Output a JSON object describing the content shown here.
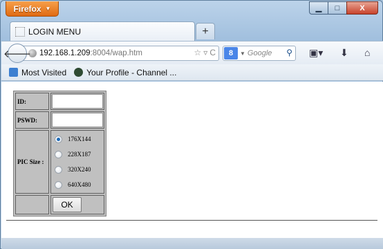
{
  "app": {
    "menu_button": "Firefox"
  },
  "window_controls": {
    "minimize": "▁",
    "maximize": "□",
    "close": "X"
  },
  "tabs": [
    {
      "title": "LOGIN MENU"
    }
  ],
  "new_tab_label": "+",
  "address_bar": {
    "host": "192.168.1.209",
    "rest": ":8004/wap.htm"
  },
  "search": {
    "engine_badge": "8",
    "placeholder": "Google"
  },
  "bookmarks": [
    {
      "label": "Most Visited"
    },
    {
      "label": "Your Profile - Channel ..."
    }
  ],
  "form": {
    "id_label": "ID:",
    "id_value": "",
    "pswd_label": "PSWD:",
    "pswd_value": "",
    "pic_size_label": "PIC Size :",
    "pic_sizes": [
      {
        "label": "176X144",
        "checked": true
      },
      {
        "label": "228X187",
        "checked": false
      },
      {
        "label": "320X240",
        "checked": false
      },
      {
        "label": "640X480",
        "checked": false
      }
    ],
    "ok_label": "OK"
  },
  "colors": {
    "firefox_button": "#e06a12",
    "window_frame": "#a9c3dc",
    "radio_checked": "#1e6bb8"
  }
}
